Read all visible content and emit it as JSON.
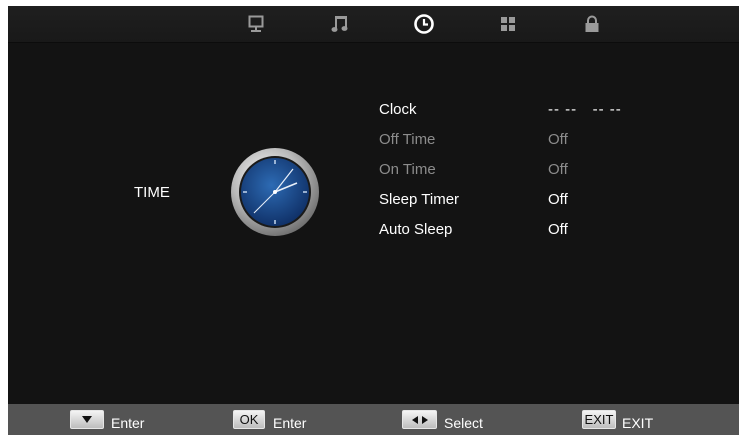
{
  "tabs": [
    {
      "name": "picture",
      "icon": "monitor-icon",
      "active": false
    },
    {
      "name": "sound",
      "icon": "music-note-icon",
      "active": false
    },
    {
      "name": "time",
      "icon": "clock-icon",
      "active": true
    },
    {
      "name": "setup",
      "icon": "grid-icon",
      "active": false
    },
    {
      "name": "lock",
      "icon": "padlock-icon",
      "active": false
    }
  ],
  "section": {
    "label": "TIME",
    "icon": "analog-clock-icon"
  },
  "menu": [
    {
      "label": "Clock",
      "value": "-- --   -- --",
      "enabled": true
    },
    {
      "label": "Off Time",
      "value": "Off",
      "enabled": false
    },
    {
      "label": "On Time",
      "value": "Off",
      "enabled": false
    },
    {
      "label": "Sleep Timer",
      "value": "Off",
      "enabled": true
    },
    {
      "label": "Auto Sleep",
      "value": "Off",
      "enabled": true
    }
  ],
  "footer": [
    {
      "key_icon": "down-arrow-key-icon",
      "key_label": "",
      "text": "Enter"
    },
    {
      "key_icon": "ok-key-icon",
      "key_label": "OK",
      "text": "Enter"
    },
    {
      "key_icon": "left-right-arrow-key-icon",
      "key_label": "",
      "text": "Select"
    },
    {
      "key_icon": "exit-key-icon",
      "key_label": "EXIT",
      "text": "EXIT"
    }
  ],
  "colors": {
    "background": "#131313",
    "footer": "#545454",
    "enabled_text": "#ffffff",
    "disabled_text": "#8c8c8c"
  }
}
